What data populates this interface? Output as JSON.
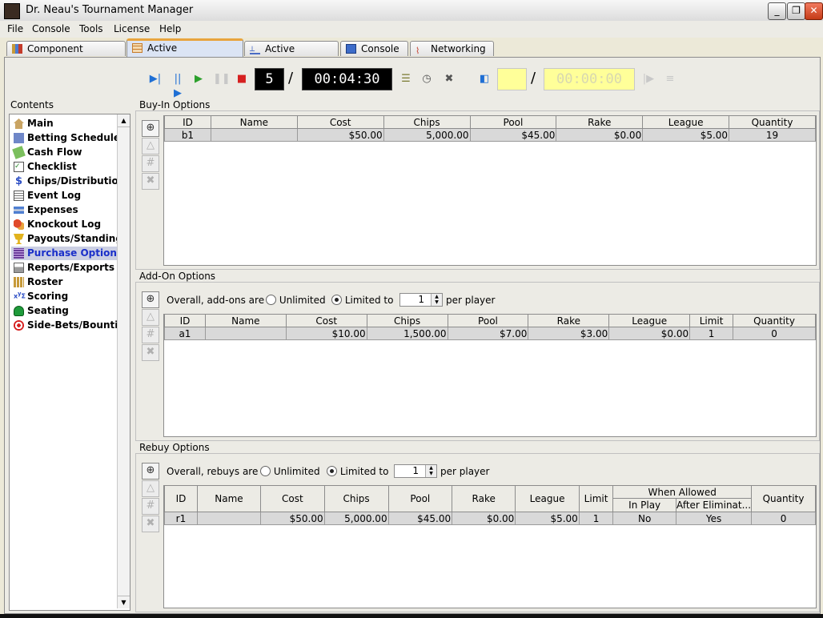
{
  "window": {
    "title": "Dr. Neau's Tournament Manager"
  },
  "menu": [
    "File",
    "Console",
    "Tools",
    "License",
    "Help"
  ],
  "tabs": [
    {
      "label": "Component Library",
      "icon": "library-icon"
    },
    {
      "label": "Active Tournament",
      "icon": "tournament-grid-icon",
      "active": true
    },
    {
      "label": "Active League",
      "icon": "league-tree-icon"
    },
    {
      "label": "Console",
      "icon": "monitor-icon"
    },
    {
      "label": "Networking",
      "icon": "network-icon"
    }
  ],
  "toolbar": {
    "level": "5",
    "separator": "/",
    "clock": "00:04:30",
    "right_separator": "/",
    "right_clock": "00:00:00"
  },
  "contents": {
    "label": "Contents",
    "items": [
      {
        "label": "Main",
        "icon": "house-icon"
      },
      {
        "label": "Betting Schedule",
        "icon": "schedule-icon"
      },
      {
        "label": "Cash Flow",
        "icon": "cash-icon"
      },
      {
        "label": "Checklist",
        "icon": "checklist-icon"
      },
      {
        "label": "Chips/Distribution",
        "icon": "dollar-icon"
      },
      {
        "label": "Event Log",
        "icon": "log-icon"
      },
      {
        "label": "Expenses",
        "icon": "card-icon"
      },
      {
        "label": "Knockout Log",
        "icon": "knockout-icon"
      },
      {
        "label": "Payouts/Standings",
        "icon": "trophy-icon"
      },
      {
        "label": "Purchase Options",
        "icon": "chips-stack-icon",
        "selected": true
      },
      {
        "label": "Reports/Exports",
        "icon": "printer-icon"
      },
      {
        "label": "Roster",
        "icon": "people-icon"
      },
      {
        "label": "Scoring",
        "icon": "formula-icon"
      },
      {
        "label": "Seating",
        "icon": "table-icon"
      },
      {
        "label": "Side-Bets/Bounties",
        "icon": "target-icon"
      }
    ]
  },
  "buyin": {
    "title": "Buy-In Options",
    "columns": [
      "ID",
      "Name",
      "Cost",
      "Chips",
      "Pool",
      "Rake",
      "League",
      "Quantity"
    ],
    "rows": [
      [
        "b1",
        "",
        "$50.00",
        "5,000.00",
        "$45.00",
        "$0.00",
        "$5.00",
        "19"
      ]
    ]
  },
  "addon": {
    "title": "Add-On Options",
    "overall_label": "Overall, add-ons are",
    "unlimited_label": "Unlimited",
    "limited_label": "Limited to",
    "limit_value": "1",
    "per_player": "per player",
    "columns": [
      "ID",
      "Name",
      "Cost",
      "Chips",
      "Pool",
      "Rake",
      "League",
      "Limit",
      "Quantity"
    ],
    "rows": [
      [
        "a1",
        "",
        "$10.00",
        "1,500.00",
        "$7.00",
        "$3.00",
        "$0.00",
        "1",
        "0"
      ]
    ]
  },
  "rebuy": {
    "title": "Rebuy Options",
    "overall_label": "Overall, rebuys are",
    "unlimited_label": "Unlimited",
    "limited_label": "Limited to",
    "limit_value": "1",
    "per_player": "per player",
    "columns": [
      "ID",
      "Name",
      "Cost",
      "Chips",
      "Pool",
      "Rake",
      "League",
      "Limit",
      "When Allowed",
      "Quantity"
    ],
    "subcolumns": [
      "In Play",
      "After Eliminat..."
    ],
    "rows": [
      [
        "r1",
        "",
        "$50.00",
        "5,000.00",
        "$45.00",
        "$0.00",
        "$5.00",
        "1",
        "No",
        "Yes",
        "0"
      ]
    ]
  },
  "colors": {
    "selection": "#1a2fc9",
    "active_tab_accent": "#e8a43e"
  }
}
